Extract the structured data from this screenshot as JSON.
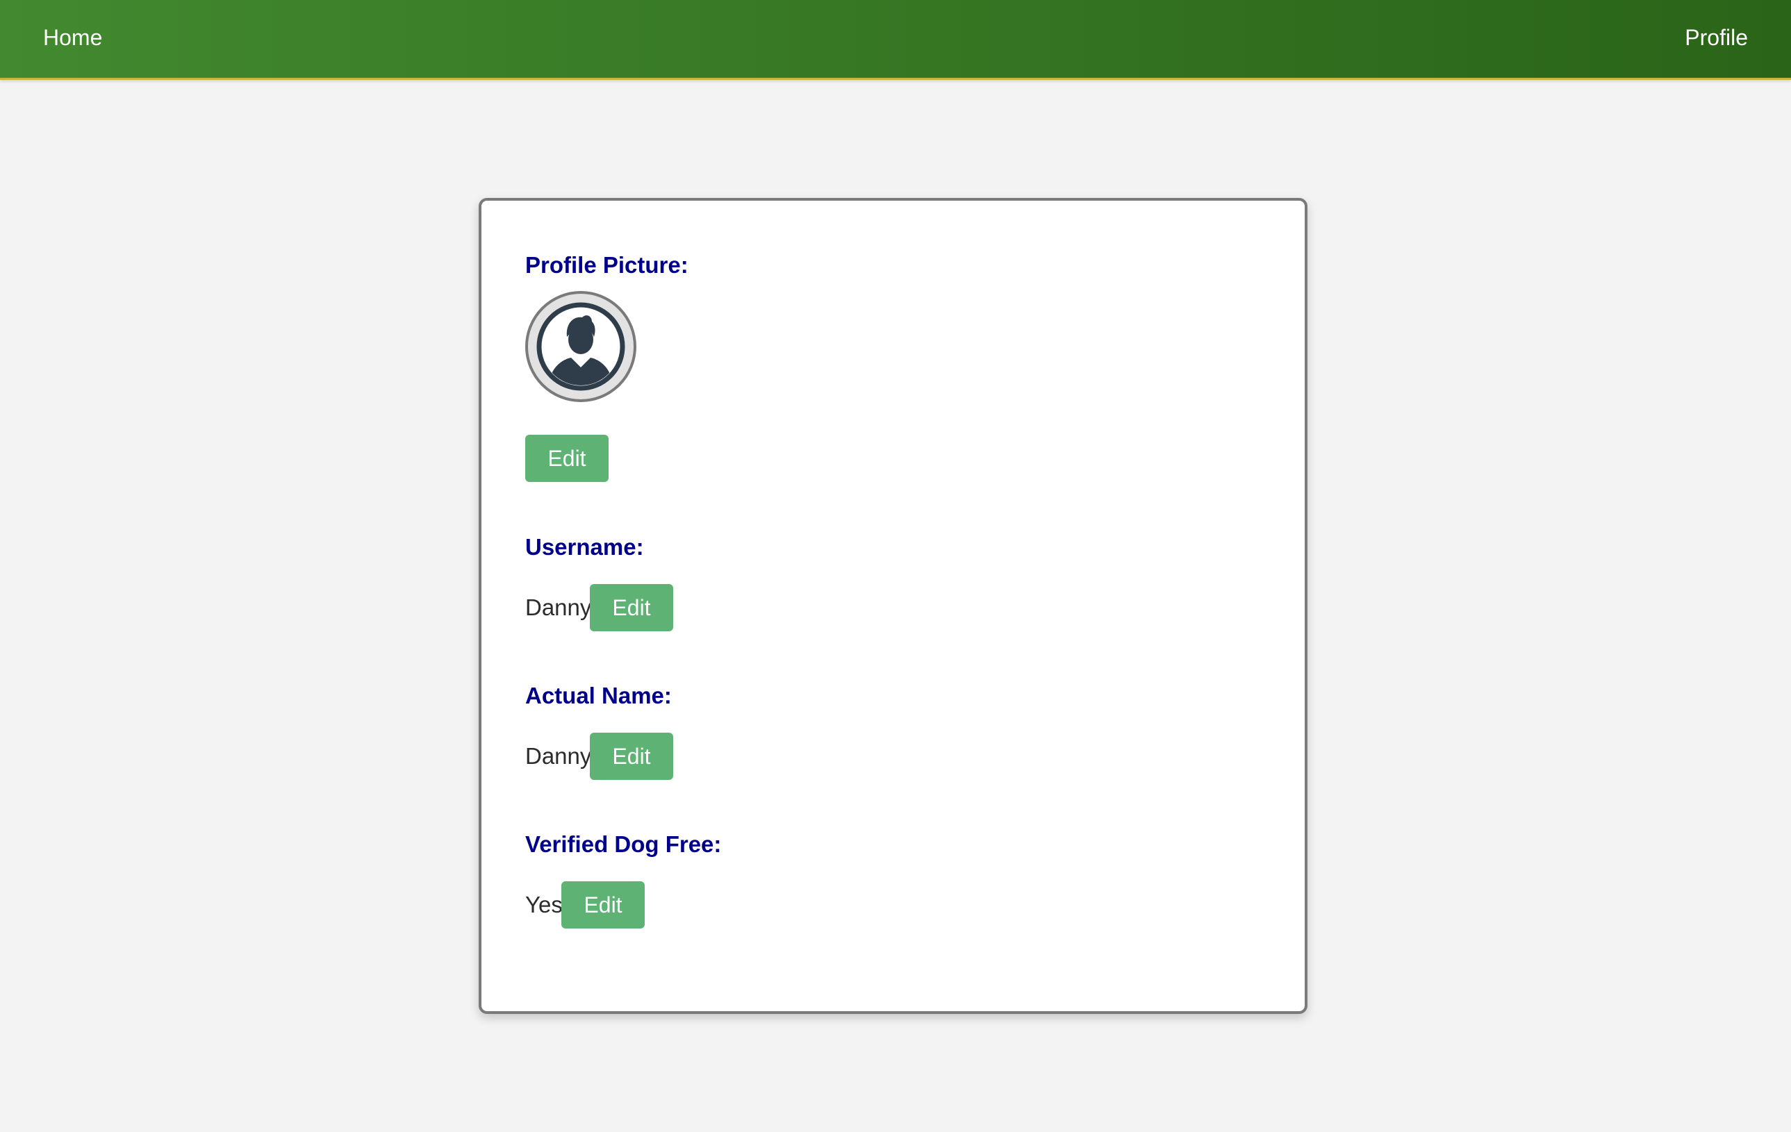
{
  "navbar": {
    "home_label": "Home",
    "profile_label": "Profile"
  },
  "profile": {
    "picture": {
      "label": "Profile Picture:",
      "icon": "user-avatar-icon",
      "edit_label": "Edit"
    },
    "username": {
      "label": "Username:",
      "value": "Danny",
      "edit_label": "Edit"
    },
    "actual_name": {
      "label": "Actual Name:",
      "value": "Danny",
      "edit_label": "Edit"
    },
    "verified_dog_free": {
      "label": "Verified Dog Free:",
      "value": "Yes",
      "edit_label": "Edit"
    }
  },
  "colors": {
    "nav_gradient_start": "#42892f",
    "nav_gradient_end": "#2a6418",
    "label_color": "#00008b",
    "button_color": "#5eb274"
  }
}
